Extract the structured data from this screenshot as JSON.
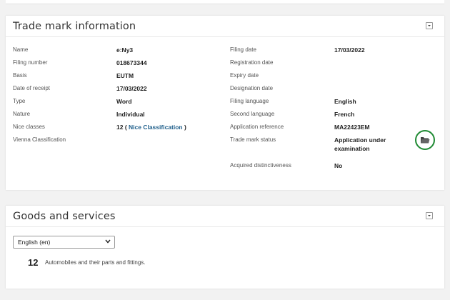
{
  "trade_mark": {
    "title": "Trade mark information",
    "left_fields": [
      {
        "label": "Name",
        "value": "e:Ny3"
      },
      {
        "label": "Filing number",
        "value": "018673344"
      },
      {
        "label": "Basis",
        "value": "EUTM"
      },
      {
        "label": "Date of receipt",
        "value": "17/03/2022"
      },
      {
        "label": "Type",
        "value": "Word"
      },
      {
        "label": "Nature",
        "value": "Individual"
      },
      {
        "label": "Nice classes",
        "value_prefix": "12 ( ",
        "link": "Nice Classification",
        "value_suffix": " )"
      },
      {
        "label": "Vienna Classification",
        "value": ""
      }
    ],
    "right_fields": [
      {
        "label": "Filing date",
        "value": "17/03/2022"
      },
      {
        "label": "Registration date",
        "value": ""
      },
      {
        "label": "Expiry date",
        "value": ""
      },
      {
        "label": "Designation date",
        "value": ""
      },
      {
        "label": "Filing language",
        "value": "English"
      },
      {
        "label": "Second language",
        "value": "French"
      },
      {
        "label": "Application reference",
        "value": "MA22423EM"
      },
      {
        "label": "Trade mark status",
        "value_line1": "Application under",
        "value_line2": "examination"
      },
      {
        "label": "Acquired distinctiveness",
        "value": "No"
      }
    ],
    "status_icon": "folder-icon",
    "status_color": "#1f8a33"
  },
  "goods": {
    "title": "Goods and services",
    "language_selected": "English (en)",
    "items": [
      {
        "class": "12",
        "text": "Automobiles and their parts and fittings."
      }
    ]
  },
  "colors": {
    "link": "#1f5f8b",
    "status_green": "#1f8a33"
  }
}
